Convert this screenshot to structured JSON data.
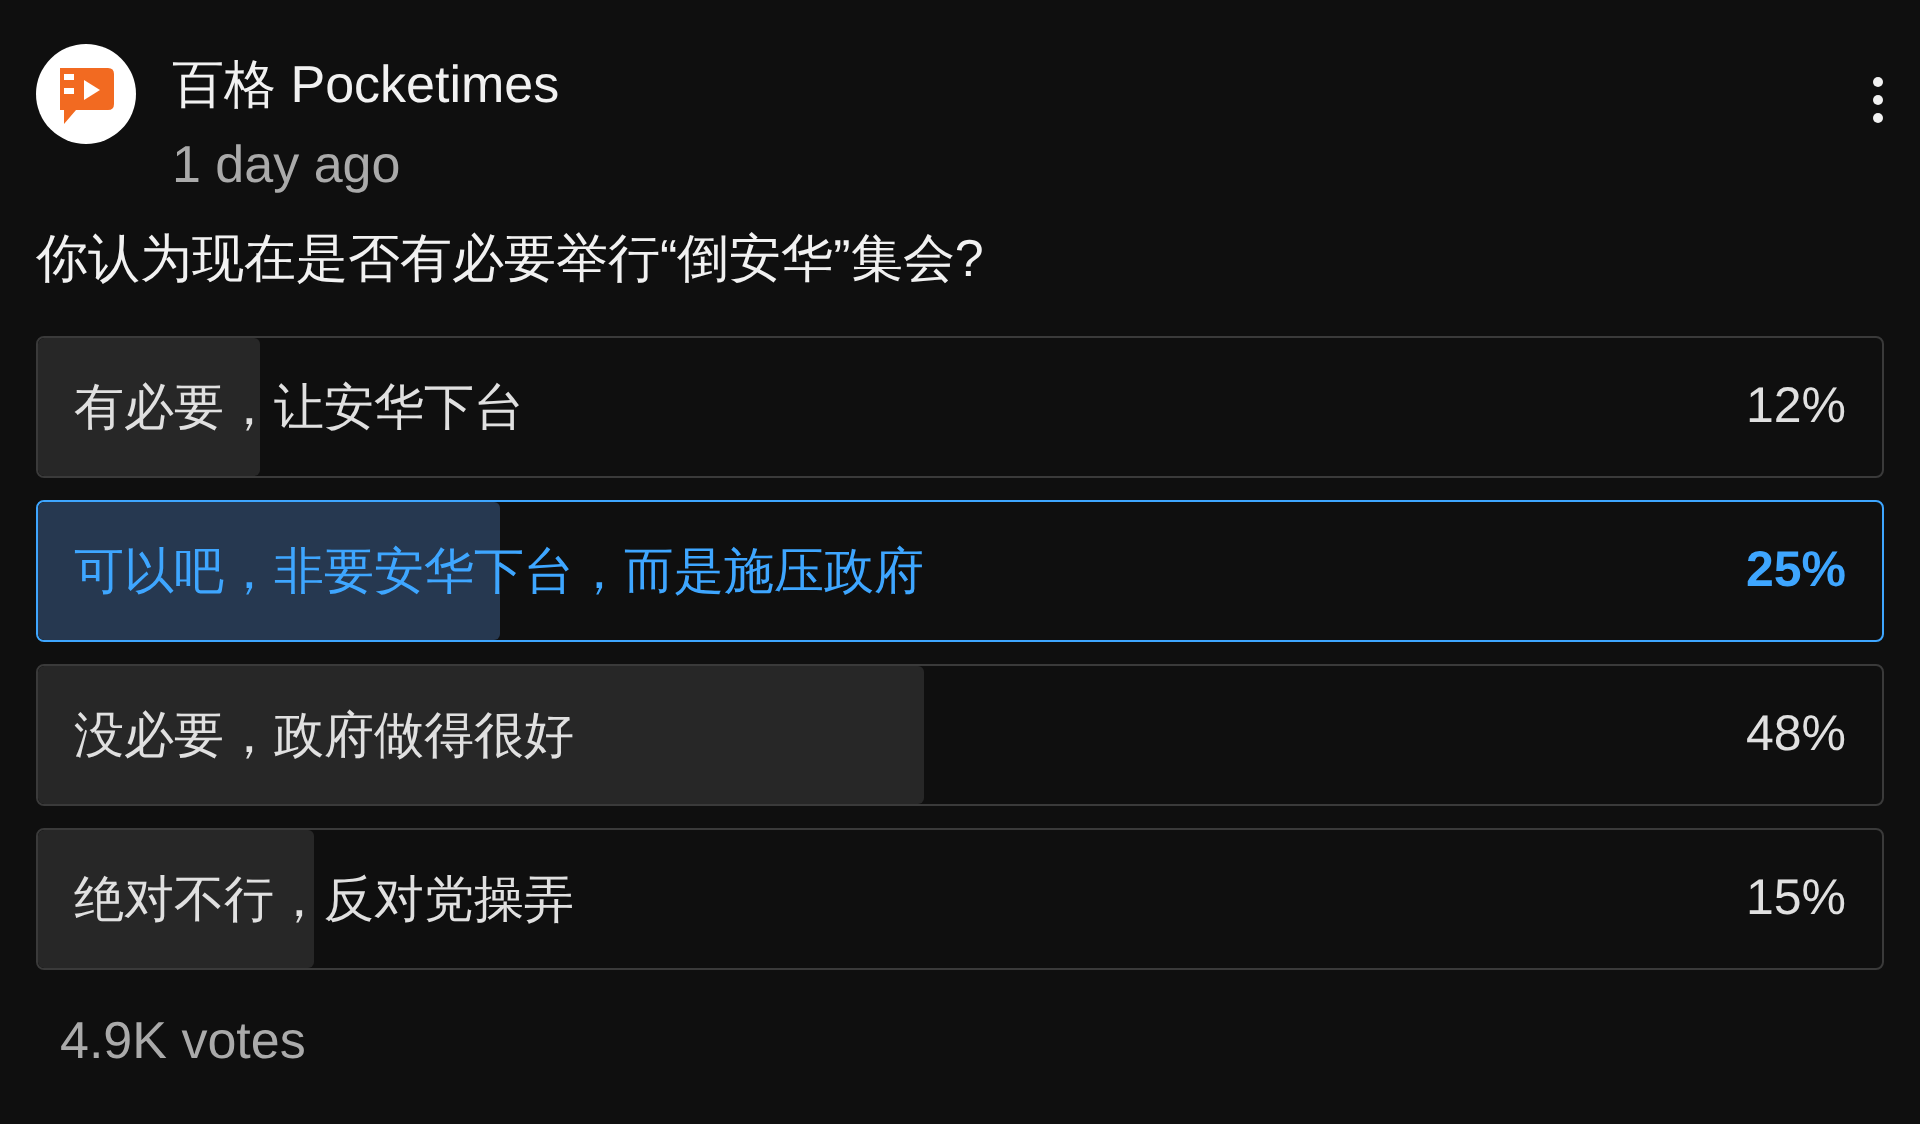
{
  "post": {
    "channel": "百格 Pocketimes",
    "time": "1 day ago",
    "question": "你认为现在是否有必要举行“倒安华”集会?"
  },
  "poll": {
    "options": [
      {
        "label": "有必要，让安华下台",
        "percent": "12%",
        "level": 0.12,
        "selected": false
      },
      {
        "label": "可以吧，非要安华下台，而是施压政府",
        "percent": "25%",
        "level": 0.25,
        "selected": true
      },
      {
        "label": "没必要，政府做得很好",
        "percent": "48%",
        "level": 0.48,
        "selected": false
      },
      {
        "label": "绝对不行，反对党操弄",
        "percent": "15%",
        "level": 0.15,
        "selected": false
      }
    ],
    "votes": "4.9K votes"
  }
}
